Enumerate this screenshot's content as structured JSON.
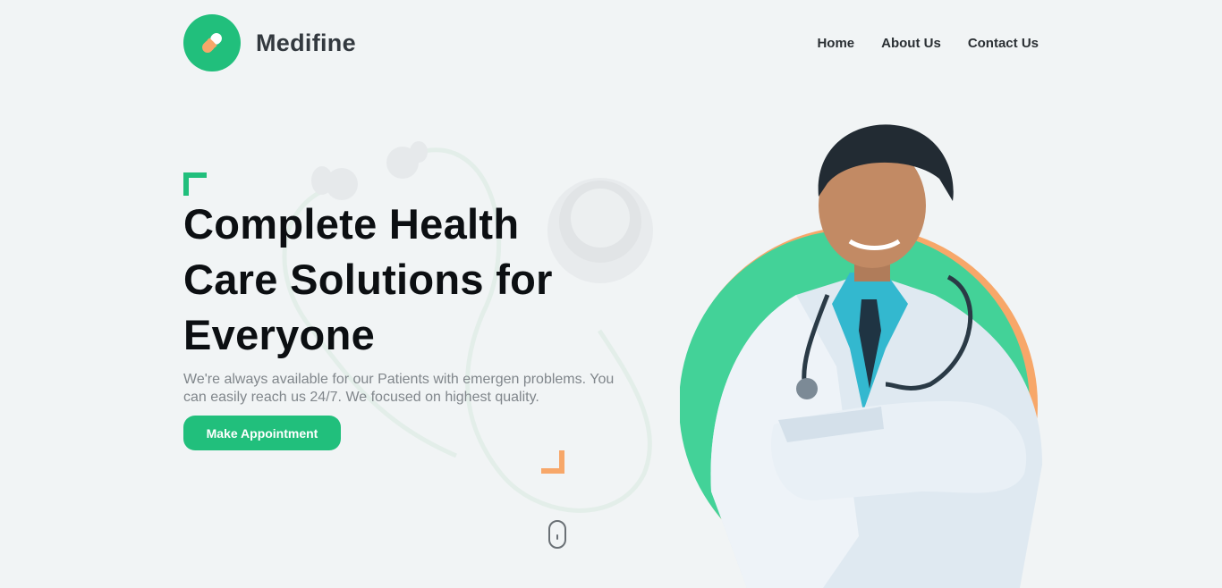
{
  "brand": {
    "name": "Medifine",
    "icon": "pill-icon"
  },
  "nav": {
    "items": [
      "Home",
      "About Us",
      "Contact Us"
    ]
  },
  "hero": {
    "title": "Complete Health Care Solutions for Everyone",
    "description": "We're always available for our Patients with emergen problems. You can easily reach us 24/7. We focused on highest quality.",
    "cta_label": "Make Appointment"
  },
  "colors": {
    "accent": "#21bf7c",
    "secondary": "#f7a769",
    "background": "#f1f4f5"
  }
}
